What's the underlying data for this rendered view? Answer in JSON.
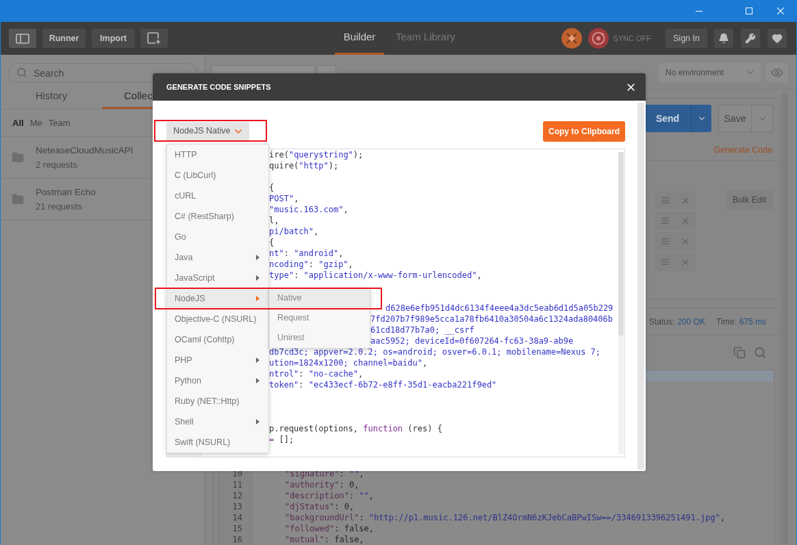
{
  "header": {
    "buttons": [
      {
        "label": "Runner"
      },
      {
        "label": "Import"
      }
    ],
    "tabs": [
      {
        "label": "Builder",
        "selected": true
      },
      {
        "label": "Team Library",
        "selected": false
      }
    ],
    "sync_status": "SYNC OFF",
    "sign_in": "Sign In"
  },
  "sidebar": {
    "search": {
      "placeholder": "Search"
    },
    "tabs": [
      {
        "label": "History",
        "selected": false
      },
      {
        "label": "Collec",
        "selected": true
      }
    ],
    "filters": [
      {
        "label": "All",
        "selected": true
      },
      {
        "label": "Me",
        "selected": false
      },
      {
        "label": "Team",
        "selected": false
      }
    ],
    "collections": [
      {
        "name": "NeteaseCloudMusicAPI",
        "count": "2 requests"
      },
      {
        "name": "Postman Echo",
        "count": "21 requests"
      }
    ]
  },
  "request": {
    "environment": "No environment",
    "send": "Send",
    "save": "Save",
    "generate_code": "Generate Code",
    "bulk_edit": "Bulk Edit"
  },
  "response": {
    "status_label": "Status:",
    "status": "200 OK",
    "time_label": "Time:",
    "time": "675 ms",
    "lines": [
      {
        "number": "10",
        "tokens": [
          {
            "kind": "key",
            "text": "\"signature\""
          },
          {
            "kind": "plain",
            "text": ": "
          },
          {
            "kind": "string",
            "text": "\"\""
          },
          {
            "kind": "plain",
            "text": ","
          }
        ]
      },
      {
        "number": "11",
        "tokens": [
          {
            "kind": "key",
            "text": "\"authority\""
          },
          {
            "kind": "plain",
            "text": ": 0,"
          }
        ]
      },
      {
        "number": "12",
        "tokens": [
          {
            "kind": "key",
            "text": "\"description\""
          },
          {
            "kind": "plain",
            "text": ": "
          },
          {
            "kind": "string",
            "text": "\"\""
          },
          {
            "kind": "plain",
            "text": ","
          }
        ]
      },
      {
        "number": "13",
        "tokens": [
          {
            "kind": "key",
            "text": "\"djStatus\""
          },
          {
            "kind": "plain",
            "text": ": 0,"
          }
        ]
      },
      {
        "number": "14",
        "tokens": [
          {
            "kind": "key",
            "text": "\"backgroundUrl\""
          },
          {
            "kind": "plain",
            "text": ": "
          },
          {
            "kind": "string",
            "text": "\"http://p1.music.126.net/BlZ4OrmN6zKJebCaBPwISw==/3346913396251491.jpg\""
          },
          {
            "kind": "plain",
            "text": ","
          }
        ]
      },
      {
        "number": "15",
        "tokens": [
          {
            "kind": "key",
            "text": "\"followed\""
          },
          {
            "kind": "plain",
            "text": ": false,"
          }
        ]
      },
      {
        "number": "16",
        "tokens": [
          {
            "kind": "key",
            "text": "\"mutual\""
          },
          {
            "kind": "plain",
            "text": ": false,"
          }
        ]
      }
    ]
  },
  "modal": {
    "title": "GENERATE CODE SNIPPETS",
    "language": "NodeJS Native",
    "copy_button": "Copy to Clipboard",
    "code_blocks": [
      {
        "lines": [
          {
            "tokens": [
              {
                "kind": "plain",
                "text": "ire("
              },
              {
                "kind": "string",
                "text": "\"querystring\""
              },
              {
                "kind": "plain",
                "text": ");"
              }
            ]
          },
          {
            "tokens": [
              {
                "kind": "plain",
                "text": "quire("
              },
              {
                "kind": "string",
                "text": "\"http\""
              },
              {
                "kind": "plain",
                "text": ");"
              }
            ]
          }
        ]
      },
      {
        "lines": [
          {
            "tokens": [
              {
                "kind": "plain",
                "text": "{"
              }
            ]
          },
          {
            "tokens": [
              {
                "kind": "string",
                "text": "POST\""
              },
              {
                "kind": "plain",
                "text": ","
              }
            ]
          },
          {
            "tokens": [
              {
                "kind": "string",
                "text": "\"music.163.com\""
              },
              {
                "kind": "plain",
                "text": ","
              }
            ]
          },
          {
            "tokens": [
              {
                "kind": "plain",
                "text": "l,"
              }
            ]
          },
          {
            "tokens": [
              {
                "kind": "string",
                "text": "pi/batch\""
              },
              {
                "kind": "plain",
                "text": ","
              }
            ]
          },
          {
            "tokens": [
              {
                "kind": "plain",
                "text": "{"
              }
            ]
          },
          {
            "tokens": [
              {
                "kind": "string",
                "text": "nt\""
              },
              {
                "kind": "plain",
                "text": ": "
              },
              {
                "kind": "string",
                "text": "\"android\""
              },
              {
                "kind": "plain",
                "text": ","
              }
            ]
          },
          {
            "tokens": [
              {
                "kind": "string",
                "text": "ncoding\""
              },
              {
                "kind": "plain",
                "text": ": "
              },
              {
                "kind": "string",
                "text": "\"gzip\""
              },
              {
                "kind": "plain",
                "text": ","
              }
            ]
          },
          {
            "tokens": [
              {
                "kind": "string",
                "text": "type\""
              },
              {
                "kind": "plain",
                "text": ": "
              },
              {
                "kind": "string",
                "text": "\"application/x-www-form-urlencoded\""
              },
              {
                "kind": "plain",
                "text": ","
              }
            ]
          }
        ]
      },
      {
        "lines": [
          {
            "tokens": [
              {
                "kind": "string",
                "text": "d628e6efb951d4dc6134f4eee4a3dc5eab6d1d5a05b229"
              }
            ]
          },
          {
            "tokens": [
              {
                "kind": "string",
                "text": "7fd207b7f989e5cca1a78fb6410a30504a6c1324ada80406b"
              }
            ]
          },
          {
            "tokens": [
              {
                "kind": "string",
                "text": "61cd18d77b7a0; __csrf"
              }
            ]
          },
          {
            "tokens": [
              {
                "kind": "string",
                "text": "aac5952; deviceId=0f607264-fc63-38a9-ab9e"
              }
            ]
          },
          {
            "tokens": [
              {
                "kind": "string",
                "text": "db7cd3c; appver=2.0.2; os=android; osver=6.0.1; mobilename=Nexus 7;"
              }
            ]
          },
          {
            "tokens": [
              {
                "kind": "string",
                "text": "ution=1824x1200; channel=baidu\""
              },
              {
                "kind": "plain",
                "text": ","
              }
            ]
          },
          {
            "tokens": [
              {
                "kind": "string",
                "text": "ntrol\""
              },
              {
                "kind": "plain",
                "text": ": "
              },
              {
                "kind": "string",
                "text": "\"no-cache\""
              },
              {
                "kind": "plain",
                "text": ","
              }
            ]
          },
          {
            "tokens": [
              {
                "kind": "string",
                "text": "token\""
              },
              {
                "kind": "plain",
                "text": ": "
              },
              {
                "kind": "string",
                "text": "\"ec433ecf-6b72-e8ff-35d1-eacba221f9ed\""
              }
            ]
          }
        ]
      },
      {
        "lines": [
          {
            "tokens": [
              {
                "kind": "plain",
                "text": "p.request(options, "
              },
              {
                "kind": "keyword",
                "text": "function"
              },
              {
                "kind": "plain",
                "text": " (res) {"
              }
            ]
          },
          {
            "tokens": [
              {
                "kind": "keyword",
                "text": "="
              },
              {
                "kind": "plain",
                "text": " [];"
              }
            ]
          }
        ]
      }
    ],
    "menu": [
      {
        "label": "HTTP",
        "selected": false,
        "has_submenu": false
      },
      {
        "label": "C (LibCurl)",
        "selected": false,
        "has_submenu": false
      },
      {
        "label": "cURL",
        "selected": false,
        "has_submenu": false
      },
      {
        "label": "C# (RestSharp)",
        "selected": false,
        "has_submenu": false
      },
      {
        "label": "Go",
        "selected": false,
        "has_submenu": false
      },
      {
        "label": "Java",
        "selected": false,
        "has_submenu": true
      },
      {
        "label": "JavaScript",
        "selected": false,
        "has_submenu": true
      },
      {
        "label": "NodeJS",
        "selected": true,
        "has_submenu": true
      },
      {
        "label": "Objective-C (NSURL)",
        "selected": false,
        "has_submenu": false
      },
      {
        "label": "OCaml (Cohttp)",
        "selected": false,
        "has_submenu": false
      },
      {
        "label": "PHP",
        "selected": false,
        "has_submenu": true
      },
      {
        "label": "Python",
        "selected": false,
        "has_submenu": true
      },
      {
        "label": "Ruby (NET::Http)",
        "selected": false,
        "has_submenu": false
      },
      {
        "label": "Shell",
        "selected": false,
        "has_submenu": true
      },
      {
        "label": "Swift (NSURL)",
        "selected": false,
        "has_submenu": false
      }
    ],
    "submenu": [
      {
        "label": "Native",
        "selected": true
      },
      {
        "label": "Request",
        "selected": false
      },
      {
        "label": "Unirest",
        "selected": false
      }
    ]
  }
}
